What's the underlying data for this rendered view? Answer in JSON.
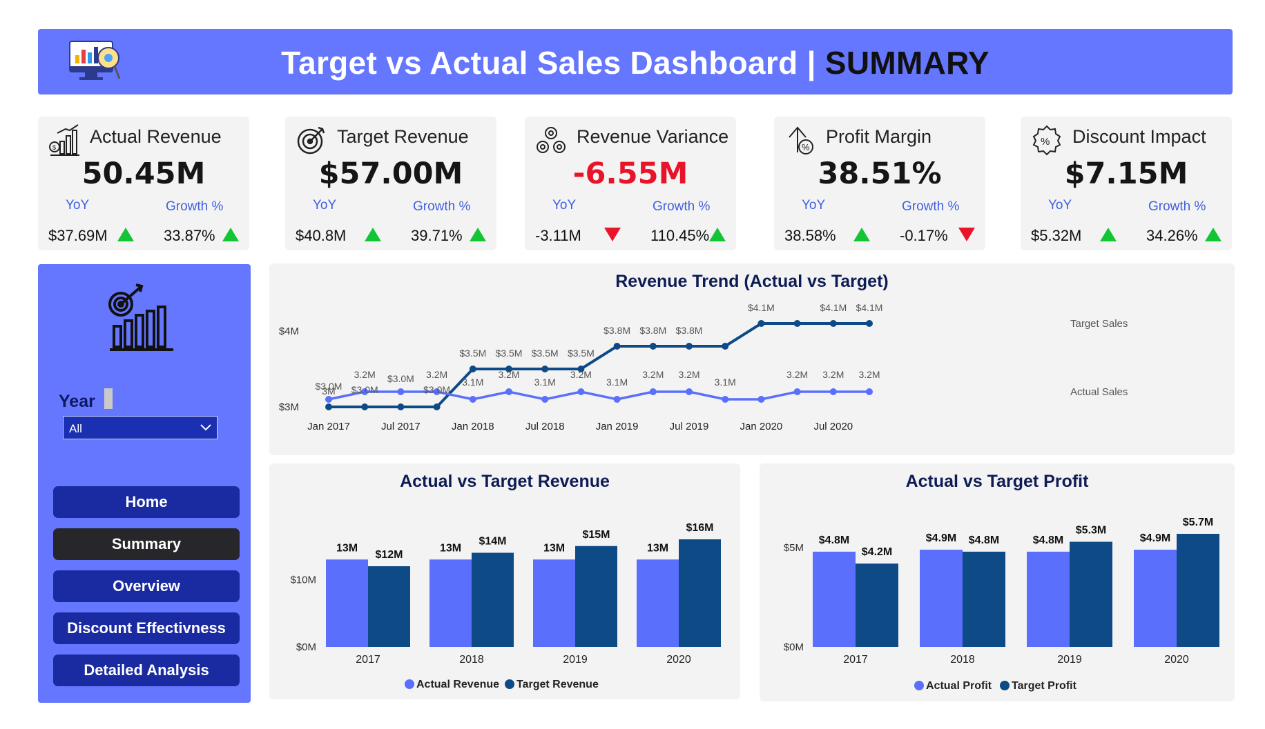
{
  "header": {
    "title_main": "Target vs Actual Sales Dashboard | ",
    "title_bold": "SUMMARY"
  },
  "kpis": [
    {
      "title": "Actual Revenue",
      "value": "50.45M",
      "yoy_label": "YoY",
      "growth_label": "Growth %",
      "yoy_value": "$37.69M",
      "yoy_dir": "up",
      "growth_value": "33.87%",
      "growth_dir": "up",
      "icon": "bar-chart-money-icon"
    },
    {
      "title": "Target Revenue",
      "value": "$57.00M",
      "yoy_label": "YoY",
      "growth_label": "Growth %",
      "yoy_value": "$40.8M",
      "yoy_dir": "up",
      "growth_value": "39.71%",
      "growth_dir": "up",
      "icon": "target-icon"
    },
    {
      "title": "Revenue Variance",
      "value": "-6.55M",
      "negative": true,
      "yoy_label": "YoY",
      "growth_label": "Growth %",
      "yoy_value": "-3.11M",
      "yoy_dir": "down",
      "growth_value": "110.45%",
      "growth_dir": "up",
      "icon": "gears-icon"
    },
    {
      "title": "Profit Margin",
      "value": "38.51%",
      "yoy_label": "YoY",
      "growth_label": "Growth %",
      "yoy_value": "38.58%",
      "yoy_dir": "up",
      "growth_value": "-0.17%",
      "growth_dir": "down",
      "icon": "percent-arrow-icon"
    },
    {
      "title": "Discount Impact",
      "value": "$7.15M",
      "yoy_label": "YoY",
      "growth_label": "Growth %",
      "yoy_value": "$5.32M",
      "yoy_dir": "up",
      "growth_value": "34.26%",
      "growth_dir": "up",
      "icon": "discount-badge-icon"
    }
  ],
  "colors": {
    "up": "#12c535",
    "down": "#e8142a",
    "actual": "#5a6ffc",
    "target": "#0e4a86",
    "sidebar": "#6576ff"
  },
  "sidebar": {
    "year_label": "Year",
    "year_value": "All",
    "nav": [
      "Home",
      "Summary",
      "Overview",
      "Discount Effectivness",
      "Detailed Analysis"
    ],
    "active_nav": "Summary"
  },
  "chart_data": [
    {
      "type": "line",
      "title": "Revenue Trend (Actual vs Target)",
      "x": [
        "Jan 2017",
        "Apr 2017",
        "Jul 2017",
        "Oct 2017",
        "Jan 2018",
        "Apr 2018",
        "Jul 2018",
        "Oct 2018",
        "Jan 2019",
        "Apr 2019",
        "Jul 2019",
        "Oct 2019",
        "Jan 2020",
        "Apr 2020",
        "Jul 2020",
        "Oct 2020"
      ],
      "x_tick_labels": [
        "Jan 2017",
        "Jul 2017",
        "Jan 2018",
        "Jul 2018",
        "Jan 2019",
        "Jul 2019",
        "Jan 2020",
        "Jul 2020"
      ],
      "y_tick_labels": [
        "$4M",
        "$3M"
      ],
      "ylim": [
        3.0,
        4.0
      ],
      "series": [
        {
          "name": "Target Sales",
          "values": [
            3.0,
            3.0,
            3.0,
            3.0,
            3.5,
            3.5,
            3.5,
            3.5,
            3.8,
            3.8,
            3.8,
            3.8,
            4.1,
            4.1,
            4.1,
            4.1
          ],
          "labels": [
            "3M",
            "",
            "",
            "",
            "$3.5M",
            "$3.5M",
            "$3.5M",
            "$3.5M",
            "$3.8M",
            "$3.8M",
            "$3.8M",
            "",
            "$4.1M",
            "",
            "$4.1M",
            "$4.1M"
          ]
        },
        {
          "name": "Actual Sales",
          "values": [
            3.1,
            3.2,
            3.2,
            3.2,
            3.1,
            3.2,
            3.1,
            3.2,
            3.1,
            3.2,
            3.2,
            3.1,
            3.1,
            3.2,
            3.2,
            3.2
          ],
          "labels": [
            "$3.0M",
            "3.2M",
            "$3.0M",
            "3.2M",
            "3.1M",
            "3.2M",
            "3.1M",
            "3.2M",
            "3.1M",
            "3.2M",
            "3.2M",
            "3.1M",
            "",
            "3.2M",
            "3.2M",
            "3.2M"
          ]
        }
      ],
      "extra_labels": [
        "$3.0M",
        "$3.0M"
      ]
    },
    {
      "type": "bar",
      "title": "Actual vs Target Revenue",
      "categories": [
        "2017",
        "2018",
        "2019",
        "2020"
      ],
      "y_tick_labels": [
        "$10M",
        "$0M"
      ],
      "ylim": [
        0,
        16
      ],
      "series": [
        {
          "name": "Actual Revenue",
          "values": [
            13,
            13,
            13,
            13
          ],
          "labels": [
            "13M",
            "13M",
            "13M",
            "13M"
          ]
        },
        {
          "name": "Target Revenue",
          "values": [
            12,
            14,
            15,
            16
          ],
          "labels": [
            "$12M",
            "$14M",
            "$15M",
            "$16M"
          ]
        }
      ]
    },
    {
      "type": "bar",
      "title": "Actual vs Target Profit",
      "categories": [
        "2017",
        "2018",
        "2019",
        "2020"
      ],
      "y_tick_labels": [
        "$5M",
        "$0M"
      ],
      "ylim": [
        0,
        5.7
      ],
      "series": [
        {
          "name": "Actual Profit",
          "values": [
            4.8,
            4.9,
            4.8,
            4.9
          ],
          "labels": [
            "$4.8M",
            "$4.9M",
            "$4.8M",
            "$4.9M"
          ]
        },
        {
          "name": "Target Profit",
          "values": [
            4.2,
            4.8,
            5.3,
            5.7
          ],
          "labels": [
            "$4.2M",
            "$4.8M",
            "$5.3M",
            "$5.7M"
          ]
        }
      ]
    }
  ]
}
